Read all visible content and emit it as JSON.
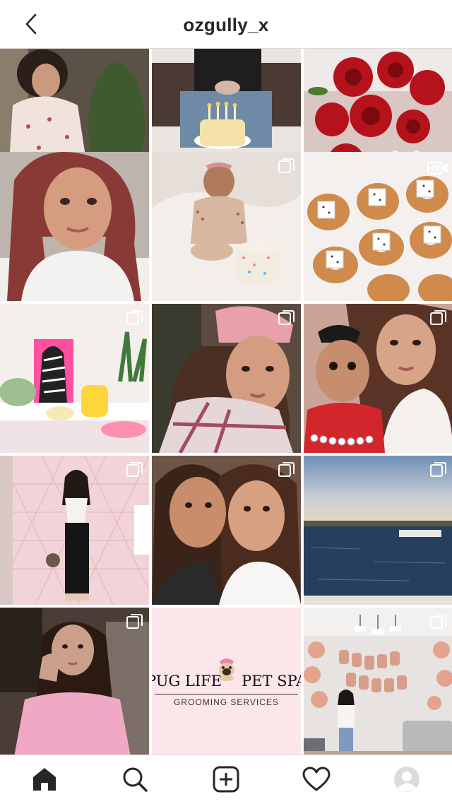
{
  "header": {
    "username": "ozgully_x",
    "back_icon": "chevron-left-icon"
  },
  "grid": {
    "posts": [
      {
        "subject": "woman in heart-print hoodie",
        "badge": "none"
      },
      {
        "subject": "birthday cake with candles",
        "badge": "none"
      },
      {
        "subject": "red roses bouquet",
        "badge": "none"
      },
      {
        "subject": "selfie with pink wavy hair",
        "badge": "none"
      },
      {
        "subject": "baby with cake",
        "badge": "multiple"
      },
      {
        "subject": "donuts in box",
        "badge": "video"
      },
      {
        "subject": "pink shelf decor with zebra print",
        "badge": "multiple"
      },
      {
        "subject": "selfie in pink beanie",
        "badge": "multiple"
      },
      {
        "subject": "woman with baby",
        "badge": "multiple"
      },
      {
        "subject": "mirror photo on pink tiles",
        "badge": "multiple"
      },
      {
        "subject": "two women selfie",
        "badge": "multiple"
      },
      {
        "subject": "sea at sunset",
        "badge": "multiple"
      },
      {
        "subject": "woman in pink dress",
        "badge": "multiple"
      },
      {
        "subject": "Pug Life Pet Spa logo",
        "badge": "none"
      },
      {
        "subject": "happy birthday balloons",
        "badge": "multiple"
      }
    ],
    "spa_logo": {
      "left_text": "PUG LIFE",
      "right_text": "PET SPA",
      "subtitle": "GROOMING SERVICES"
    }
  },
  "nav": {
    "items": [
      {
        "icon": "home-icon",
        "active": true
      },
      {
        "icon": "search-icon",
        "active": false
      },
      {
        "icon": "add-post-icon",
        "active": false
      },
      {
        "icon": "heart-icon",
        "active": false
      },
      {
        "icon": "profile-avatar-icon",
        "active": false
      }
    ]
  },
  "colors": {
    "text": "#262626",
    "border": "#dbdbdb",
    "background": "#ffffff",
    "spa_pink": "#fbe6ea"
  }
}
